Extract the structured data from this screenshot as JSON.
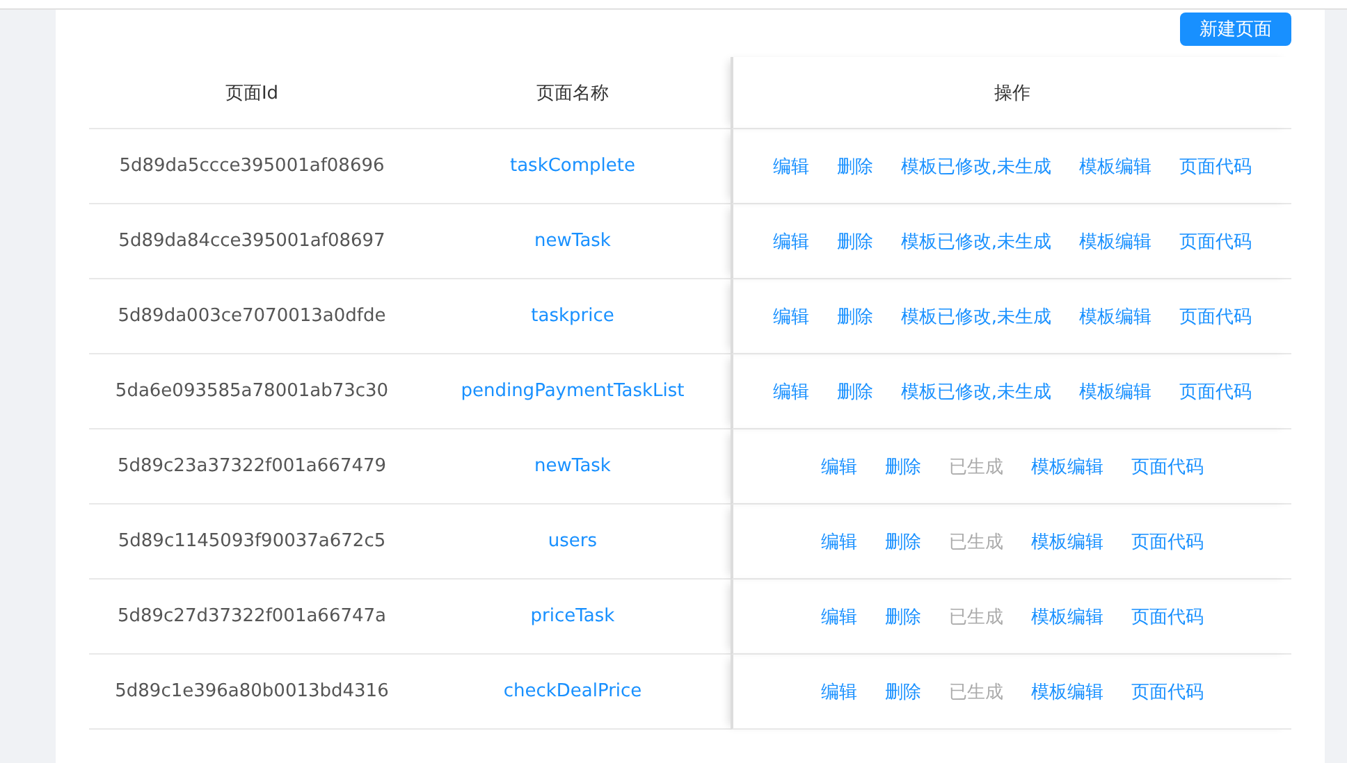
{
  "toolbar": {
    "create_button": "新建页面"
  },
  "table": {
    "columns": [
      "页面Id",
      "页面名称",
      "操作"
    ],
    "rows": [
      {
        "id": "5d89da5ccce395001af08696",
        "name": "taskComplete",
        "actions": [
          {
            "label": "编辑",
            "disabled": false
          },
          {
            "label": "删除",
            "disabled": false
          },
          {
            "label": "模板已修改,未生成",
            "disabled": false
          },
          {
            "label": "模板编辑",
            "disabled": false
          },
          {
            "label": "页面代码",
            "disabled": false
          }
        ]
      },
      {
        "id": "5d89da84cce395001af08697",
        "name": "newTask",
        "actions": [
          {
            "label": "编辑",
            "disabled": false
          },
          {
            "label": "删除",
            "disabled": false
          },
          {
            "label": "模板已修改,未生成",
            "disabled": false
          },
          {
            "label": "模板编辑",
            "disabled": false
          },
          {
            "label": "页面代码",
            "disabled": false
          }
        ]
      },
      {
        "id": "5d89da003ce7070013a0dfde",
        "name": "taskprice",
        "actions": [
          {
            "label": "编辑",
            "disabled": false
          },
          {
            "label": "删除",
            "disabled": false
          },
          {
            "label": "模板已修改,未生成",
            "disabled": false
          },
          {
            "label": "模板编辑",
            "disabled": false
          },
          {
            "label": "页面代码",
            "disabled": false
          }
        ]
      },
      {
        "id": "5da6e093585a78001ab73c30",
        "name": "pendingPaymentTaskList",
        "actions": [
          {
            "label": "编辑",
            "disabled": false
          },
          {
            "label": "删除",
            "disabled": false
          },
          {
            "label": "模板已修改,未生成",
            "disabled": false
          },
          {
            "label": "模板编辑",
            "disabled": false
          },
          {
            "label": "页面代码",
            "disabled": false
          }
        ]
      },
      {
        "id": "5d89c23a37322f001a667479",
        "name": "newTask",
        "actions": [
          {
            "label": "编辑",
            "disabled": false
          },
          {
            "label": "删除",
            "disabled": false
          },
          {
            "label": "已生成",
            "disabled": true
          },
          {
            "label": "模板编辑",
            "disabled": false
          },
          {
            "label": "页面代码",
            "disabled": false
          }
        ]
      },
      {
        "id": "5d89c1145093f90037a672c5",
        "name": "users",
        "actions": [
          {
            "label": "编辑",
            "disabled": false
          },
          {
            "label": "删除",
            "disabled": false
          },
          {
            "label": "已生成",
            "disabled": true
          },
          {
            "label": "模板编辑",
            "disabled": false
          },
          {
            "label": "页面代码",
            "disabled": false
          }
        ]
      },
      {
        "id": "5d89c27d37322f001a66747a",
        "name": "priceTask",
        "actions": [
          {
            "label": "编辑",
            "disabled": false
          },
          {
            "label": "删除",
            "disabled": false
          },
          {
            "label": "已生成",
            "disabled": true
          },
          {
            "label": "模板编辑",
            "disabled": false
          },
          {
            "label": "页面代码",
            "disabled": false
          }
        ]
      },
      {
        "id": "5d89c1e396a80b0013bd4316",
        "name": "checkDealPrice",
        "actions": [
          {
            "label": "编辑",
            "disabled": false
          },
          {
            "label": "删除",
            "disabled": false
          },
          {
            "label": "已生成",
            "disabled": true
          },
          {
            "label": "模板编辑",
            "disabled": false
          },
          {
            "label": "页面代码",
            "disabled": false
          }
        ]
      }
    ]
  }
}
